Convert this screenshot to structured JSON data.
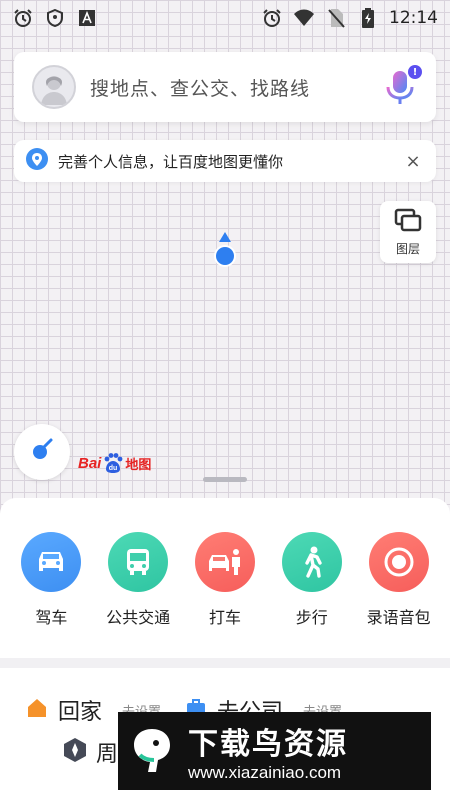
{
  "status_bar": {
    "time": "12:14",
    "left_icons": [
      "alarm-icon",
      "shield-icon",
      "font-a-icon"
    ],
    "right_icons": [
      "alarm-icon",
      "wifi-icon",
      "no-sim-icon",
      "battery-charging-icon"
    ]
  },
  "search": {
    "placeholder": "搜地点、查公交、找路线",
    "mic_badge": "!"
  },
  "notice": {
    "text": "完善个人信息，让百度地图更懂你",
    "close": "×"
  },
  "layer_button": {
    "label": "图层"
  },
  "logo": {
    "bai": "Bai",
    "du": "du",
    "map": "地图"
  },
  "nav": {
    "items": [
      {
        "label": "驾车",
        "color": "#3d8ff2",
        "icon": "car-icon"
      },
      {
        "label": "公共交通",
        "color": "#2fc5a2",
        "icon": "bus-icon"
      },
      {
        "label": "打车",
        "color": "#f65e5b",
        "icon": "taxi-icon"
      },
      {
        "label": "步行",
        "color": "#2fc5a2",
        "icon": "walk-icon"
      },
      {
        "label": "录语音包",
        "color": "#f65e5b",
        "icon": "record-icon"
      }
    ]
  },
  "quick": {
    "home_title": "回家",
    "home_sub": "去设置",
    "work_title": "去公司",
    "work_sub": "去设置",
    "sub_text": "周"
  },
  "watermark": {
    "title": "下载鸟资源",
    "url": "www.xiazainiao.com"
  },
  "colors": {
    "accent_blue": "#3d8ff2",
    "accent_green": "#2fc5a2",
    "accent_red": "#f65e5b",
    "baidu_red": "#e62424"
  }
}
